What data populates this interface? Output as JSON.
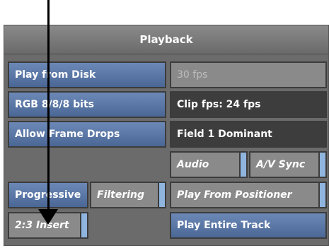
{
  "panel": {
    "title": "Playback"
  },
  "left_column": {
    "play_from_disk": "Play from Disk",
    "rgb_bits": "RGB 8/8/8 bits",
    "allow_frame_drops": "Allow Frame Drops",
    "progressive": "Progressive",
    "filtering": "Filtering",
    "insert_32": "2:3 Insert"
  },
  "right_column": {
    "fps_value": "30 fps",
    "clip_fps": "Clip fps: 24 fps",
    "field_dominant": "Field 1 Dominant",
    "audio": "Audio",
    "av_sync": "A/V Sync",
    "play_from_positioner": "Play From Positioner",
    "play_entire_track": "Play Entire Track"
  },
  "colors": {
    "panel_background": "#6b6b6b",
    "button_blue": "#5a77a6",
    "button_dark": "#3d3d3d",
    "button_grey": "#8a8a8a",
    "toggle_indicator": "#8fb4de"
  }
}
